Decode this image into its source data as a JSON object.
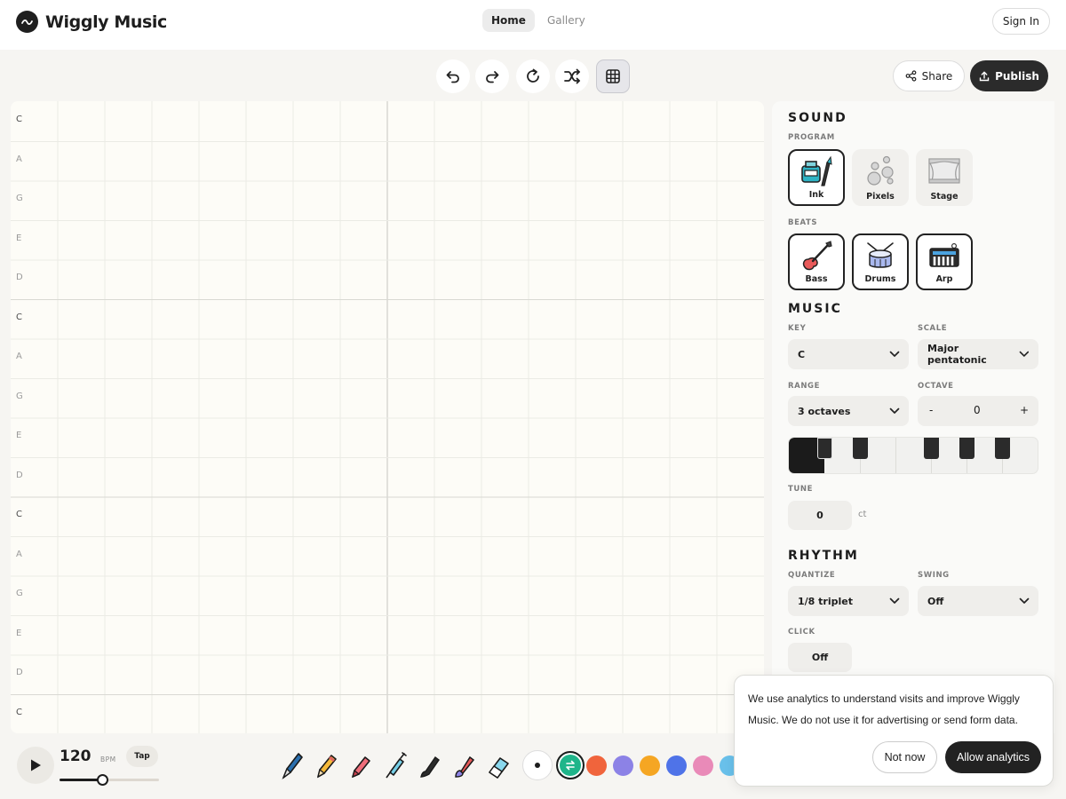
{
  "brand": {
    "name": "Wiggly Music",
    "logo_icon": "wave-logo-icon"
  },
  "nav": {
    "tabs": [
      {
        "label": "Home",
        "active": true
      },
      {
        "label": "Gallery",
        "active": false
      }
    ],
    "sign_in": "Sign In"
  },
  "toolbar": {
    "buttons": [
      "undo-icon",
      "redo-icon",
      "restart-icon",
      "shuffle-icon",
      "grid-icon"
    ],
    "share_label": "Share",
    "publish_label": "Publish"
  },
  "grid": {
    "note_labels": [
      "C",
      "A",
      "G",
      "E",
      "D",
      "C",
      "A",
      "G",
      "E",
      "D",
      "C",
      "A",
      "G",
      "E",
      "D",
      "C"
    ]
  },
  "panel": {
    "sound": {
      "title": "SOUND",
      "program_label": "PROGRAM",
      "programs": [
        {
          "label": "Ink",
          "icon": "ink-pen-icon",
          "selected": true
        },
        {
          "label": "Pixels",
          "icon": "pixels-bubbles-icon",
          "selected": false
        },
        {
          "label": "Stage",
          "icon": "stage-curtain-icon",
          "selected": false
        }
      ],
      "beats_label": "BEATS",
      "beats": [
        {
          "label": "Bass",
          "icon": "bass-guitar-icon",
          "selected": true
        },
        {
          "label": "Drums",
          "icon": "snare-drum-icon",
          "selected": true
        },
        {
          "label": "Arp",
          "icon": "keyboard-synth-icon",
          "selected": true
        }
      ]
    },
    "music": {
      "title": "MUSIC",
      "key_label": "KEY",
      "key_value": "C",
      "scale_label": "SCALE",
      "scale_value": "Major pentatonic",
      "range_label": "RANGE",
      "range_value": "3 octaves",
      "octave_label": "OCTAVE",
      "octave_minus": "-",
      "octave_value": "0",
      "octave_plus": "+",
      "tune_label": "TUNE",
      "tune_value": "0",
      "tune_unit": "ct"
    },
    "rhythm": {
      "title": "RHYTHM",
      "quantize_label": "QUANTIZE",
      "quantize_value": "1/8 triplet",
      "swing_label": "SWING",
      "swing_value": "Off",
      "click_label": "CLICK",
      "click_value": "Off"
    }
  },
  "transport": {
    "bpm": "120",
    "bpm_unit": "BPM",
    "tap_label": "Tap",
    "tempo_level": 0.43
  },
  "tools": [
    "fountain-pen-icon",
    "pencil-icon",
    "marker-icon",
    "syringe-pen-icon",
    "ink-brush-icon",
    "paint-brush-icon",
    "eraser-icon"
  ],
  "colors": {
    "selected": "#1fb58a",
    "swatches": [
      "#f0643c",
      "#8c82e6",
      "#f5a623",
      "#4f73e8",
      "#e98ab8",
      "#69c0ea"
    ]
  },
  "cookie": {
    "text": "We use analytics to understand visits and improve Wiggly Music. We do not use it for advertising or send form data.",
    "decline": "Not now",
    "accept": "Allow analytics"
  }
}
